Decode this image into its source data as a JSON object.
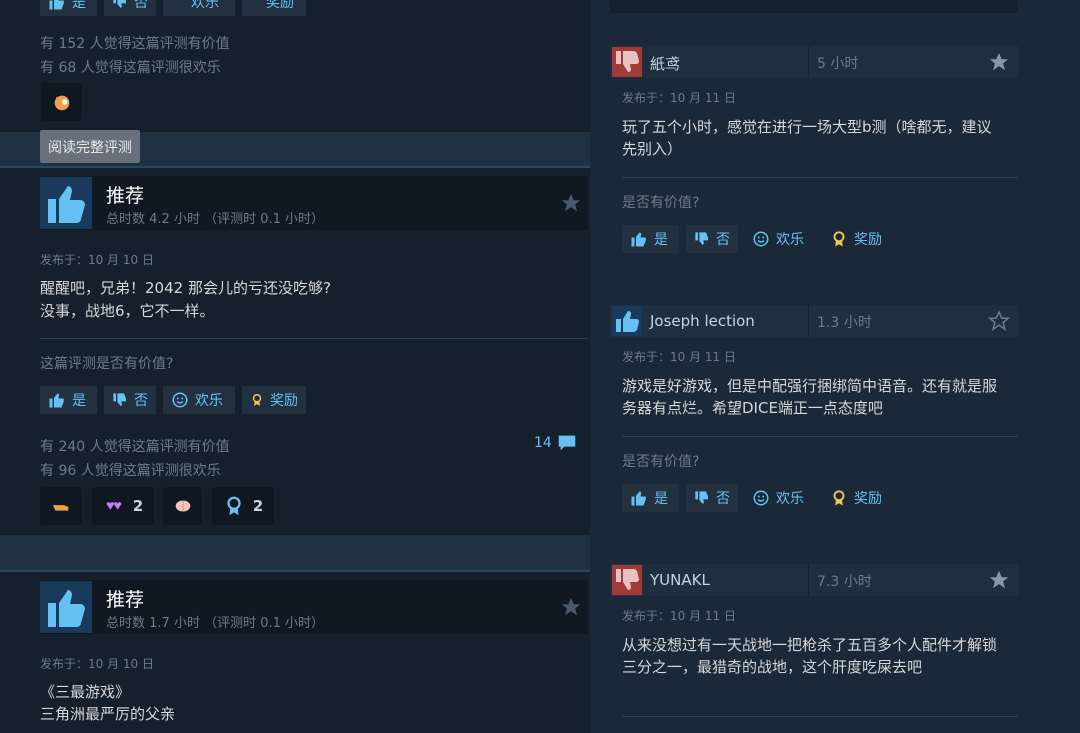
{
  "colors": {
    "accent": "#66c0f4",
    "thumb_up_bg": "#1a3a5c",
    "thumb_down_bg": "#a23a3a",
    "award_gold": "#f2c94c"
  },
  "top_review": {
    "buttons": [
      "是",
      "否",
      "欢乐",
      "奖励"
    ],
    "found_helpful": "有 152 人觉得这篇评测有价值",
    "found_funny": "有 68 人觉得这篇评测很欢乐",
    "read_full": "阅读完整评测"
  },
  "reviews_left": [
    {
      "title": "推荐",
      "hours": "总时数 4.2 小时 （评测时 0.1 小时）",
      "posted": "发布于：10 月 10 日",
      "lines": [
        "醒醒吧，兄弟！2042 那会儿的亏还没吃够?",
        "没事，战地6，它不一样。"
      ],
      "question": "这篇评测是否有价值?",
      "btn_yes": "是",
      "btn_no": "否",
      "btn_funny": "欢乐",
      "btn_award": "奖励",
      "comment_count": "14",
      "found_helpful": "有 240 人觉得这篇评测有价值",
      "found_funny": "有 96 人觉得这篇评测很欢乐",
      "awards": [
        {
          "icon": "fist-emoji-icon",
          "count": ""
        },
        {
          "icon": "heart-hands-icon",
          "count": "2"
        },
        {
          "icon": "brain-icon",
          "count": ""
        },
        {
          "icon": "medal-icon",
          "count": "2"
        }
      ]
    },
    {
      "title": "推荐",
      "hours": "总时数 1.7 小时 （评测时 0.1 小时）",
      "posted": "发布于：10 月 10 日",
      "lines": [
        "《三最游戏》",
        "三角洲最严厉的父亲"
      ]
    }
  ],
  "reviews_right": [
    {
      "name": "紙鸢",
      "hours": "5 小时",
      "thumb": "down",
      "posted": "发布于：10 月 11 日",
      "body": "玩了五个小时，感觉在进行一场大型b测（啥都无，建议先别入）",
      "question": "是否有价值?",
      "btn_yes": "是",
      "btn_no": "否",
      "btn_funny": "欢乐",
      "btn_award": "奖励"
    },
    {
      "name": "Joseph lection",
      "hours": "1.3 小时",
      "thumb": "up",
      "posted": "发布于：10 月 11 日",
      "body": "游戏是好游戏，但是中配强行捆绑简中语音。还有就是服务器有点烂。希望DICE端正一点态度吧",
      "question": "是否有价值?",
      "btn_yes": "是",
      "btn_no": "否",
      "btn_funny": "欢乐",
      "btn_award": "奖励"
    },
    {
      "name": "YUNAKL",
      "hours": "7.3 小时",
      "thumb": "down",
      "posted": "发布于：10 月 11 日",
      "body": "从来没想过有一天战地一把枪杀了五百多个人配件才解锁三分之一，最猎奇的战地，这个肝度吃屎去吧"
    }
  ]
}
